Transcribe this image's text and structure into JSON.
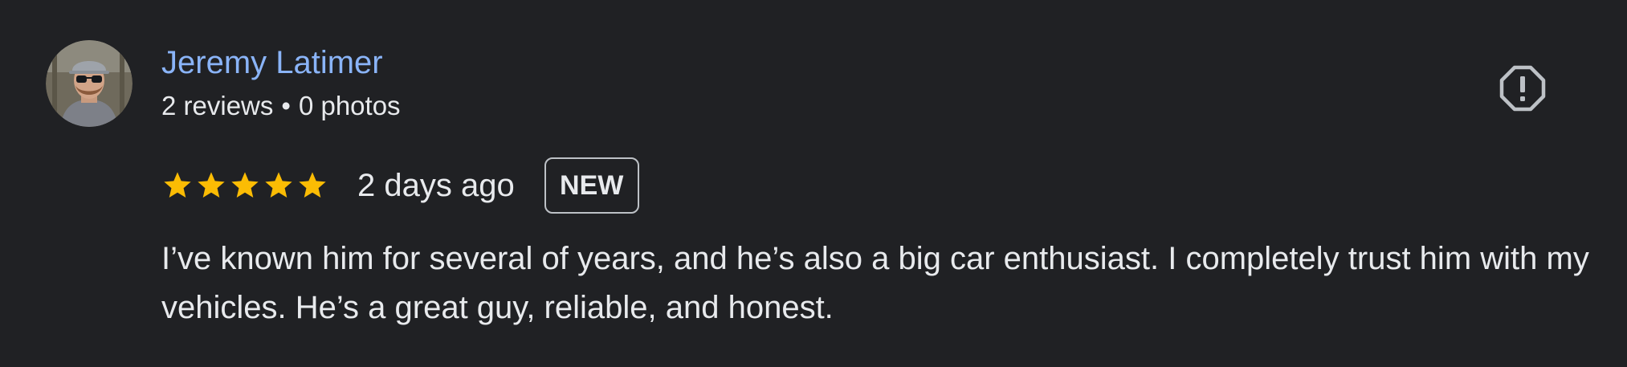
{
  "review": {
    "author_name": "Jeremy Latimer",
    "reviews_count": "2 reviews",
    "separator": "•",
    "photos_count": "0 photos",
    "rating": 5,
    "rating_max": 5,
    "date": "2 days ago",
    "badge": "NEW",
    "text": "I’ve known him for several of years, and he’s also a big car enthusiast. I completely trust him with my vehicles. He’s a great guy, reliable, and honest."
  },
  "icons": {
    "report": "octagon-exclamation-icon",
    "star": "star-icon"
  },
  "colors": {
    "background": "#202124",
    "author_link": "#8ab4f8",
    "text": "#e8eaed",
    "star": "#fbbc04",
    "icon": "#bdc1c6"
  }
}
